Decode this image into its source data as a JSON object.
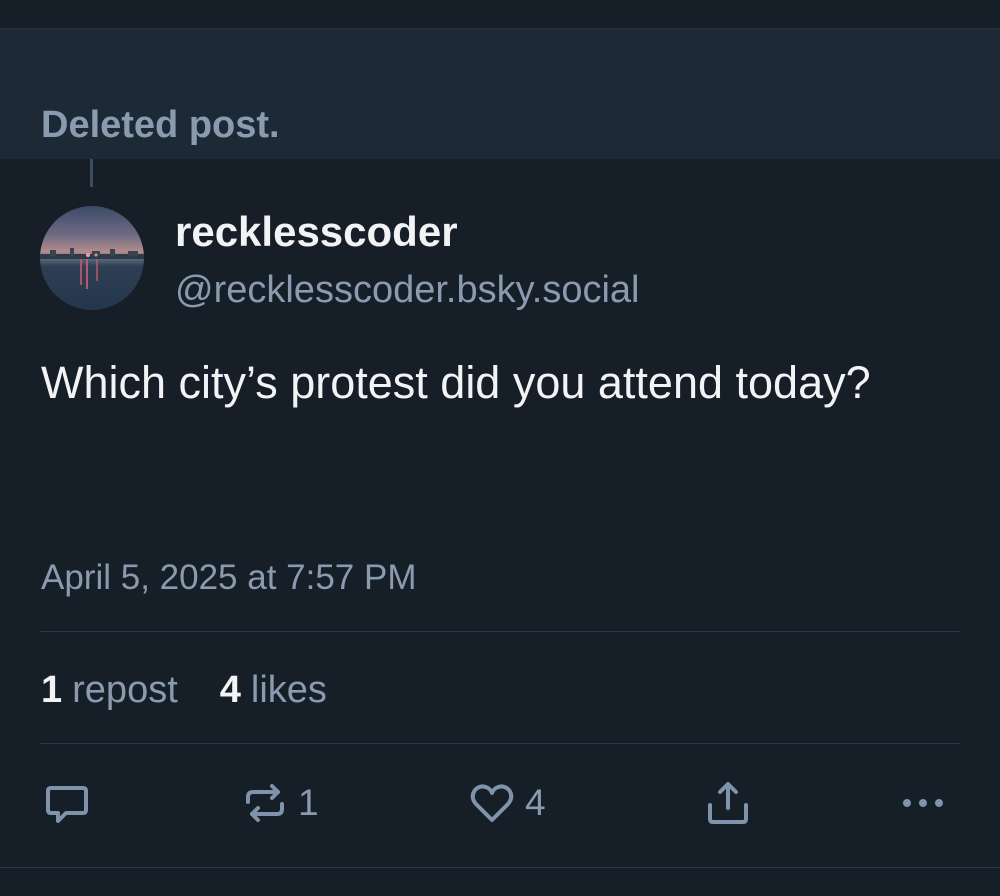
{
  "deleted_post": {
    "text": "Deleted post."
  },
  "author": {
    "display_name": "recklesscoder",
    "handle": "@recklesscoder.bsky.social",
    "avatar_icon": "avatar-photo-city-skyline"
  },
  "post": {
    "text": "Which city’s protest did you attend today?",
    "timestamp": "April 5, 2025 at 7:57 PM"
  },
  "stats": {
    "reposts_count": "1",
    "reposts_label": "repost",
    "likes_count": "4",
    "likes_label": "likes"
  },
  "actions": {
    "reply_icon": "reply-icon",
    "repost_icon": "repost-icon",
    "repost_count": "1",
    "like_icon": "heart-icon",
    "like_count": "4",
    "share_icon": "share-icon",
    "more_icon": "more-icon"
  },
  "colors": {
    "background": "#161e27",
    "deleted_card_background": "#1e2936",
    "primary_text": "#f1f3f5",
    "secondary_text": "#8a9bb0",
    "icon": "#7f93ab"
  }
}
